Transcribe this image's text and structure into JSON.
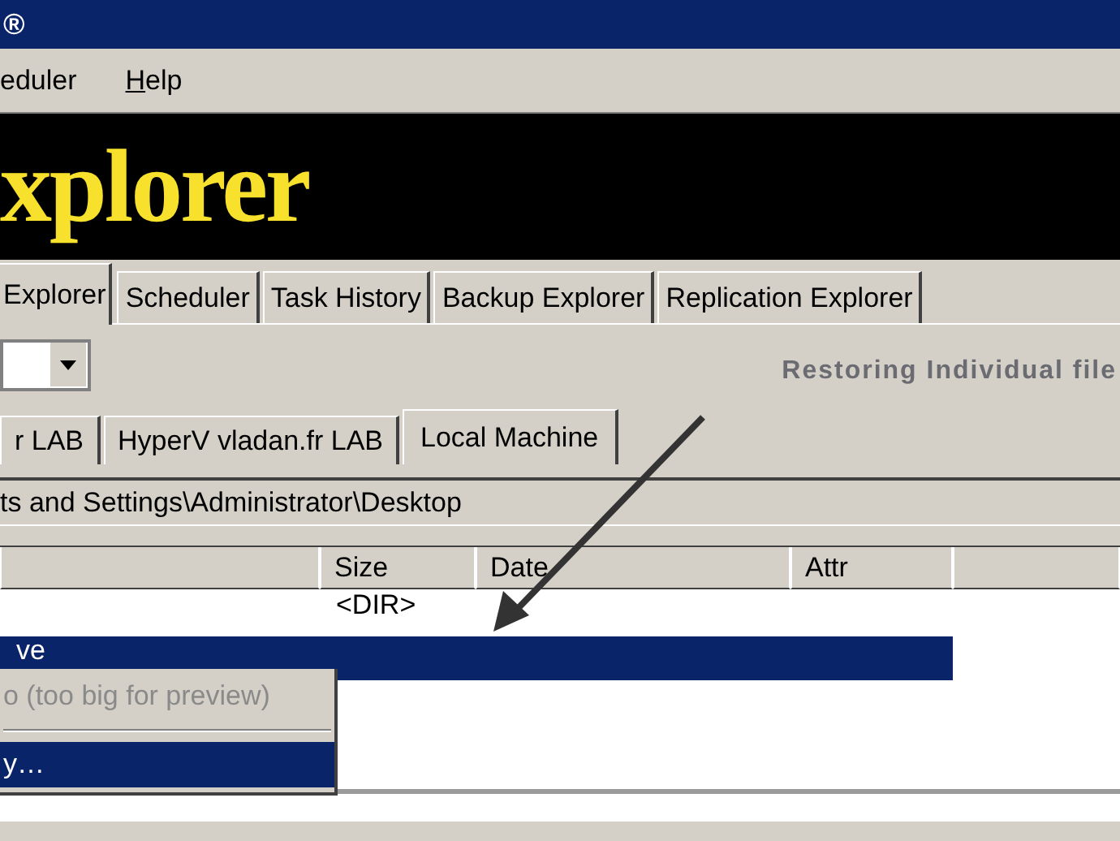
{
  "window": {
    "title": "®"
  },
  "menu": [
    {
      "label": "eduler",
      "accelerator": false
    },
    {
      "label": "Help",
      "accelerator": true
    }
  ],
  "banner": {
    "title": "xplorer"
  },
  "tabs": [
    {
      "label": "Explorer",
      "selected": true
    },
    {
      "label": "Scheduler",
      "selected": false
    },
    {
      "label": "Task History",
      "selected": false
    },
    {
      "label": "Backup Explorer",
      "selected": false
    },
    {
      "label": "Replication Explorer",
      "selected": false
    }
  ],
  "annotation": {
    "text": "Restoring Individual file"
  },
  "server_tabs": [
    {
      "label": "r LAB",
      "selected": false
    },
    {
      "label": "HyperV vladan.fr LAB",
      "selected": false
    },
    {
      "label": "Local Machine",
      "selected": true
    }
  ],
  "path": "ts and Settings\\Administrator\\Desktop",
  "table": {
    "columns": [
      "",
      "Size",
      "Date",
      "Attr",
      ""
    ],
    "rows": [
      {
        "cells": [
          "",
          "<DIR>",
          "",
          ""
        ],
        "selected": false
      },
      {
        "cells": [
          "ve",
          "",
          "",
          ""
        ],
        "selected": true
      }
    ]
  },
  "context_menu": [
    {
      "kind": "item",
      "label": "o (too big for preview)",
      "disabled": true,
      "selected": false
    },
    {
      "kind": "separator"
    },
    {
      "kind": "item",
      "label": "y…",
      "disabled": false,
      "selected": true
    }
  ]
}
